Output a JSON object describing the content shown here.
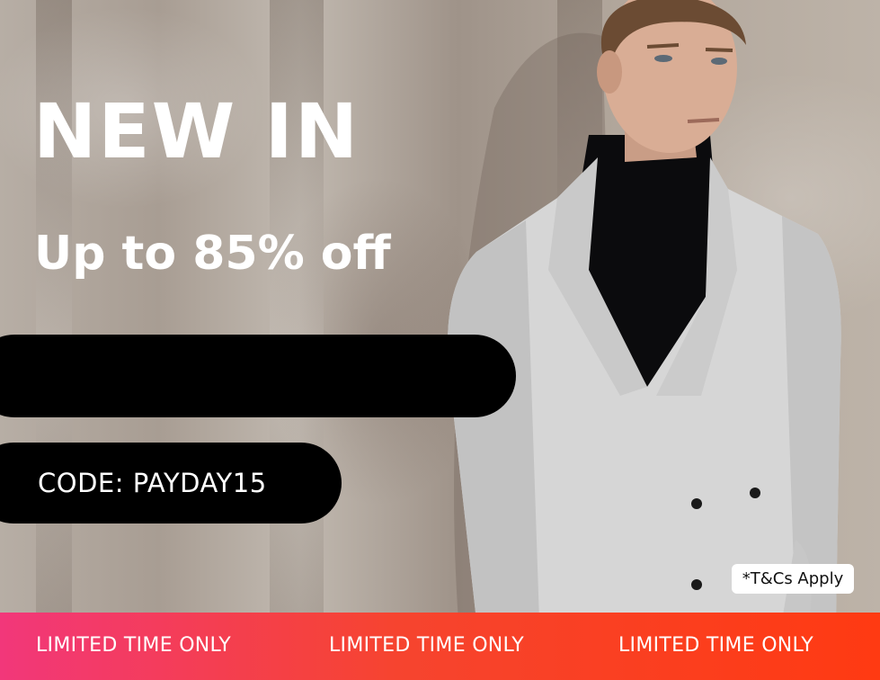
{
  "banner": {
    "headline": "NEW IN",
    "subheadline": "Up to 85% off",
    "code_label": "CODE: PAYDAY15",
    "terms": "*T&Cs Apply"
  },
  "ticker": {
    "items": [
      "LIMITED TIME ONLY",
      "LIMITED TIME ONLY",
      "LIMITED TIME ONLY"
    ]
  },
  "colors": {
    "ticker_gradient_start": "#f2377a",
    "ticker_gradient_end": "#ff3a12",
    "pill": "#000000",
    "headline_text": "#ffffff",
    "jacket": "#d6d6d6",
    "turtleneck": "#0b0b0d"
  }
}
